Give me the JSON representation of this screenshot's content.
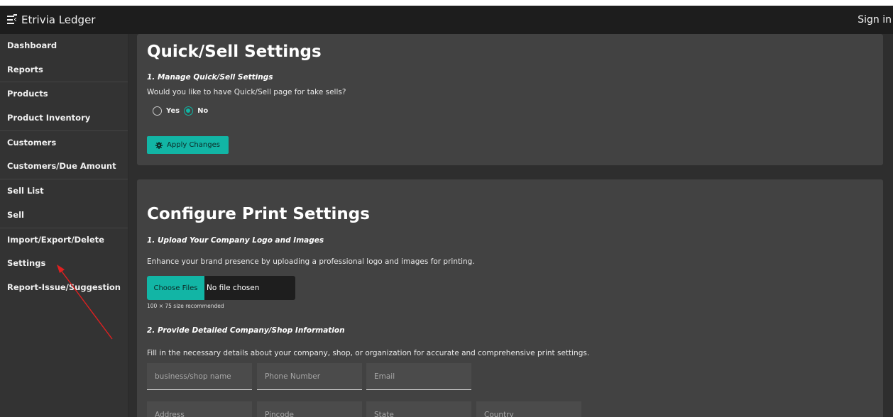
{
  "app": {
    "brand": "Etrivia Ledger",
    "sign_in": "Sign in"
  },
  "sidebar": {
    "items": [
      {
        "label": "Dashboard"
      },
      {
        "label": "Reports"
      },
      {
        "label": "Products"
      },
      {
        "label": "Product Inventory"
      },
      {
        "label": "Customers"
      },
      {
        "label": "Customers/Due Amount"
      },
      {
        "label": "Sell List"
      },
      {
        "label": "Sell"
      },
      {
        "label": "Import/Export/Delete"
      },
      {
        "label": "Settings"
      },
      {
        "label": "Report-Issue/Suggestion"
      }
    ]
  },
  "quick_sell": {
    "title": "Quick/Sell Settings",
    "section_heading": "1. Manage Quick/Sell Settings",
    "question": "Would you like to have Quick/Sell page for take sells?",
    "options": [
      {
        "label": "Yes",
        "selected": false
      },
      {
        "label": "No",
        "selected": true
      }
    ],
    "apply_label": "Apply Changes"
  },
  "print_settings": {
    "title": "Configure Print Settings",
    "upload_heading": "1. Upload Your Company Logo and Images",
    "upload_desc": "Enhance your brand presence by uploading a professional logo and images for printing.",
    "choose_files_label": "Choose Files",
    "file_status": "No file chosen",
    "size_hint": "100 × 75 size recommended",
    "info_heading": "2. Provide Detailed Company/Shop Information",
    "info_desc": "Fill in the necessary details about your company, shop, or organization for accurate and comprehensive print settings.",
    "fields": {
      "business_name": "business/shop name",
      "phone": "Phone Number",
      "email": "Email",
      "address": "Address",
      "pincode": "Pincode",
      "state": "State",
      "country": "Country"
    }
  },
  "colors": {
    "accent": "#12b5a5",
    "annotation_arrow": "#e02020"
  }
}
